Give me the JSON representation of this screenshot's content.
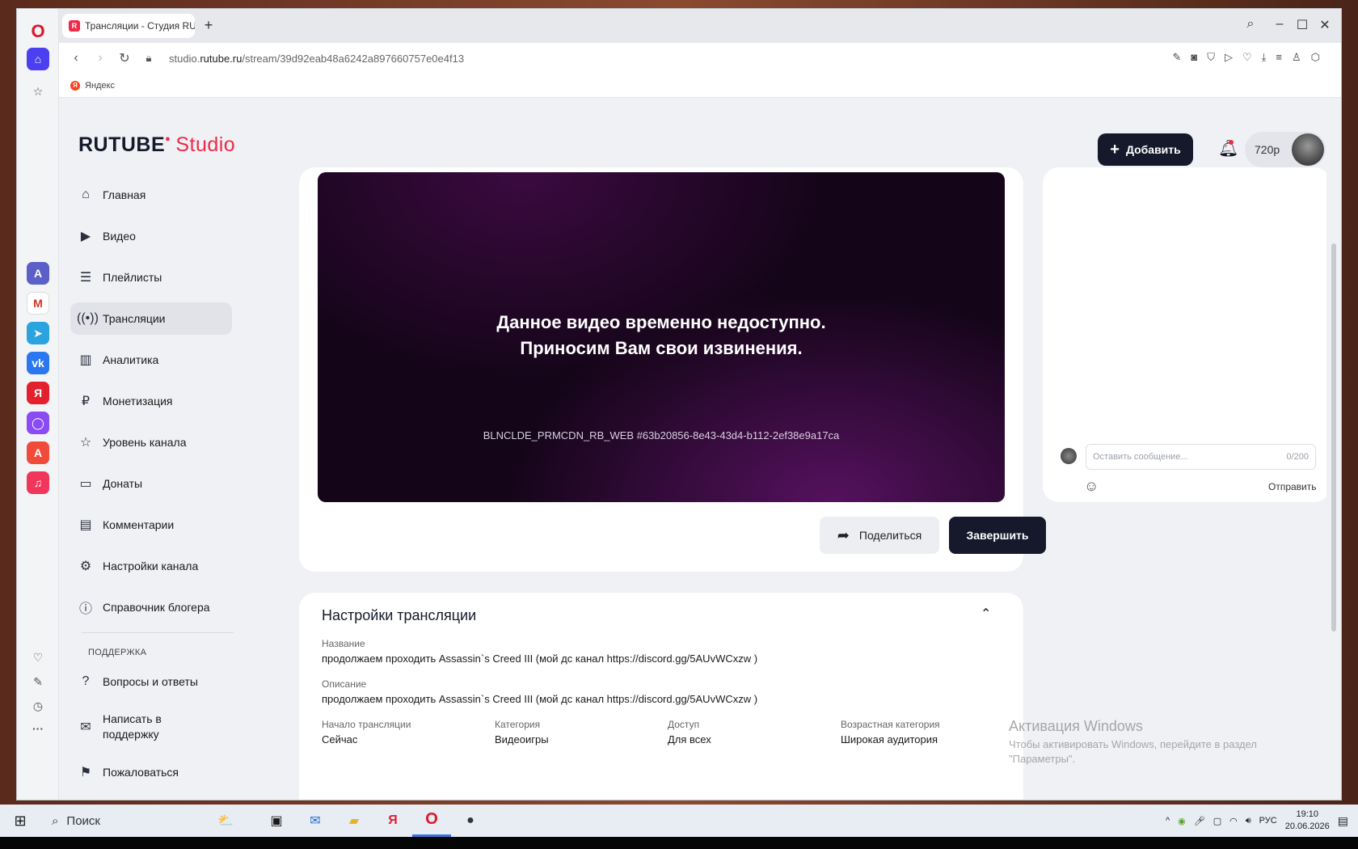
{
  "browser": {
    "tab_title": "Трансляции - Студия RU",
    "url_prefix": "studio.",
    "url_domain": "rutube.ru",
    "url_path": "/stream/39d92eab48a6242a897660757e0e4f13",
    "bookmark_label": "Яндекс"
  },
  "header": {
    "logo_main": "RUTUBE",
    "logo_studio": "Studio",
    "add_button": "Добавить",
    "user_quality": "720p"
  },
  "sidebar": {
    "items": [
      {
        "label": "Главная",
        "icon": "home-icon"
      },
      {
        "label": "Видео",
        "icon": "video-icon"
      },
      {
        "label": "Плейлисты",
        "icon": "playlist-icon"
      },
      {
        "label": "Трансляции",
        "icon": "broadcast-icon",
        "active": true
      },
      {
        "label": "Аналитика",
        "icon": "chart-icon"
      },
      {
        "label": "Монетизация",
        "icon": "ruble-icon"
      },
      {
        "label": "Уровень канала",
        "icon": "star-icon"
      },
      {
        "label": "Донаты",
        "icon": "wallet-icon"
      },
      {
        "label": "Комментарии",
        "icon": "comment-icon"
      },
      {
        "label": "Настройки канала",
        "icon": "gear-icon"
      },
      {
        "label": "Справочник блогера",
        "icon": "info-icon"
      }
    ],
    "section_support": "ПОДДЕРЖКА",
    "support_items": [
      {
        "label": "Вопросы и ответы",
        "icon": "question-icon"
      },
      {
        "label": "Написать в поддержку",
        "icon": "mail-icon"
      },
      {
        "label": "Пожаловаться",
        "icon": "flag-icon"
      }
    ]
  },
  "player": {
    "message_line1": "Данное видео временно недоступно.",
    "message_line2": "Приносим Вам свои извинения.",
    "error_code": "BLNCLDE_PRMCDN_RB_WEB #63b20856-8e43-43d4-b112-2ef38e9a17ca",
    "share_button": "Поделиться",
    "end_button": "Завершить"
  },
  "chat": {
    "placeholder": "Оставить сообщение...",
    "counter": "0/200",
    "send_button": "Отправить"
  },
  "settings": {
    "title": "Настройки трансляции",
    "name_label": "Название",
    "name_value": "продолжаем проходить Assassin`s Creed III (мой дс канал https://discord.gg/5AUvWCxzw )",
    "desc_label": "Описание",
    "desc_value": "продолжаем проходить Assassin`s Creed III (мой дс канал https://discord.gg/5AUvWCxzw )",
    "start_label": "Начало трансляции",
    "start_value": "Сейчас",
    "category_label": "Категория",
    "category_value": "Видеоигры",
    "access_label": "Доступ",
    "access_value": "Для всех",
    "age_label": "Возрастная категория",
    "age_value": "Широкая аудитория"
  },
  "watermark": {
    "title": "Активация Windows",
    "subtitle": "Чтобы активировать Windows, перейдите в раздел \"Параметры\"."
  },
  "taskbar": {
    "search": "Поиск",
    "lang": "РУС",
    "time": "19:10",
    "date": "20.06.2026"
  },
  "colors": {
    "brand_red": "#ee2a48",
    "dark": "#15192b"
  }
}
